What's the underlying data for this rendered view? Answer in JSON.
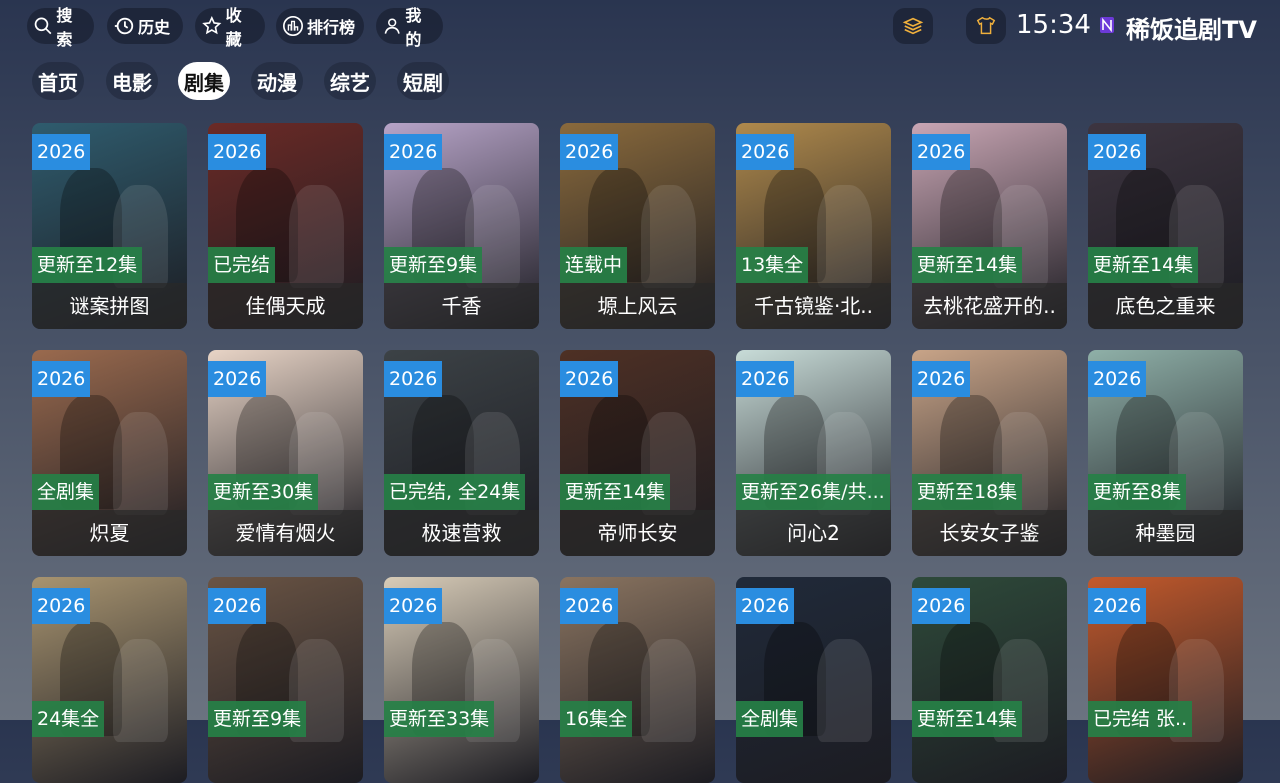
{
  "header": {
    "nav": [
      {
        "label": "搜索",
        "icon": "search-icon"
      },
      {
        "label": "历史",
        "icon": "history-icon"
      },
      {
        "label": "收藏",
        "icon": "star-icon"
      },
      {
        "label": "排行榜",
        "icon": "ranking-icon"
      },
      {
        "label": "我的",
        "icon": "user-icon"
      }
    ],
    "time": "15:34",
    "app_name": "稀饭追剧TV"
  },
  "tabs": [
    {
      "label": "首页",
      "active": false
    },
    {
      "label": "电影",
      "active": false
    },
    {
      "label": "剧集",
      "active": true
    },
    {
      "label": "动漫",
      "active": false
    },
    {
      "label": "综艺",
      "active": false
    },
    {
      "label": "短剧",
      "active": false
    }
  ],
  "grid": [
    {
      "year": "2026",
      "status": "更新至12集",
      "title": "谜案拼图",
      "color": "#2f5c6e"
    },
    {
      "year": "2026",
      "status": "已完结",
      "title": "佳偶天成",
      "color": "#6b2a26"
    },
    {
      "year": "2026",
      "status": "更新至9集",
      "title": "千香",
      "color": "#b7a4c8"
    },
    {
      "year": "2026",
      "status": "连载中",
      "title": "塬上风云",
      "color": "#8a6a3c"
    },
    {
      "year": "2026",
      "status": "13集全",
      "title": "千古镜鉴·北..",
      "color": "#b08a4c"
    },
    {
      "year": "2026",
      "status": "更新至14集",
      "title": "去桃花盛开的..",
      "color": "#c9a6b4"
    },
    {
      "year": "2026",
      "status": "更新至14集",
      "title": "底色之重来",
      "color": "#3d3540"
    },
    {
      "year": "2026",
      "status": "全剧集",
      "title": "炽夏",
      "color": "#9a6a4e"
    },
    {
      "year": "2026",
      "status": "更新至30集",
      "title": "爱情有烟火",
      "color": "#e8d4c6"
    },
    {
      "year": "2026",
      "status": "已完结, 全24集",
      "title": "极速营救",
      "color": "#3c4246"
    },
    {
      "year": "2026",
      "status": "更新至14集",
      "title": "帝师长安",
      "color": "#4e3024"
    },
    {
      "year": "2026",
      "status": "更新至26集/共...",
      "title": "问心2",
      "color": "#c8dcd8"
    },
    {
      "year": "2026",
      "status": "更新至18集",
      "title": "长安女子鉴",
      "color": "#c8a488"
    },
    {
      "year": "2026",
      "status": "更新至8集",
      "title": "种墨园",
      "color": "#8fb0a8"
    },
    {
      "year": "2026",
      "status": "24集全",
      "title": "",
      "color": "#a89470"
    },
    {
      "year": "2026",
      "status": "更新至9集",
      "title": "",
      "color": "#6a5444"
    },
    {
      "year": "2026",
      "status": "更新至33集",
      "title": "",
      "color": "#d8ccb8"
    },
    {
      "year": "2026",
      "status": "16集全",
      "title": "",
      "color": "#8a7460"
    },
    {
      "year": "2026",
      "status": "全剧集",
      "title": "",
      "color": "#202a3a"
    },
    {
      "year": "2026",
      "status": "更新至14集",
      "title": "",
      "color": "#2e4a3a"
    },
    {
      "year": "2026",
      "status": "已完结 张..",
      "title": "",
      "color": "#c45a2c"
    }
  ]
}
